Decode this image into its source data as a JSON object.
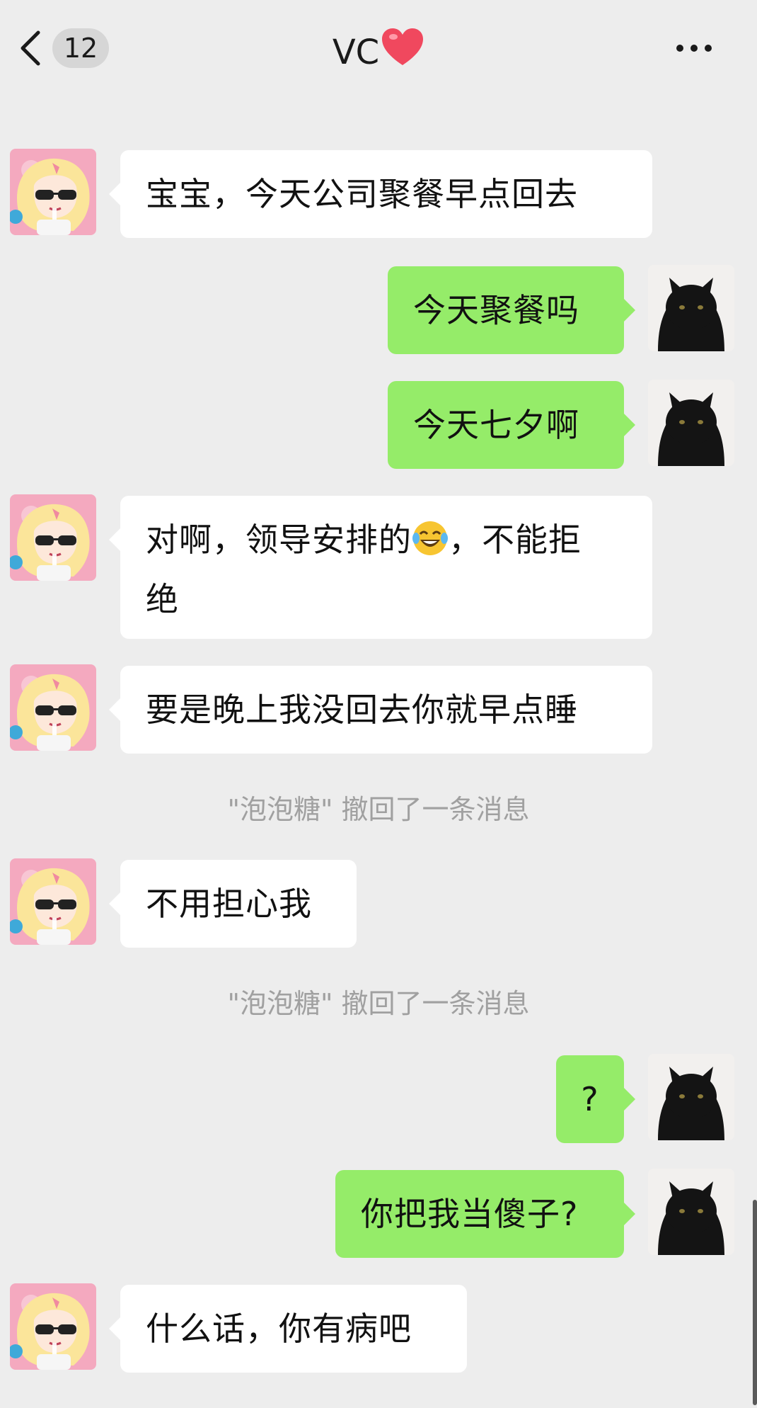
{
  "header": {
    "back_icon": "chevron-left-icon",
    "unread_count": "12",
    "title": "VC",
    "title_emoji": "heart-icon",
    "more_icon": "ellipsis-icon"
  },
  "colors": {
    "background": "#ededed",
    "incoming_bubble": "#ffffff",
    "outgoing_bubble": "#95ec69",
    "system_text": "#a0a0a0"
  },
  "messages": [
    {
      "side": "in",
      "text": "宝宝，今天公司聚餐早点回去"
    },
    {
      "side": "out",
      "text": "今天聚餐吗"
    },
    {
      "side": "out",
      "text": "今天七夕啊"
    },
    {
      "side": "in",
      "text_line1_a": "对啊，领导安排的",
      "emoji": "tears-of-joy-emoji",
      "text_line1_b": "，不能拒",
      "text_line2": "绝"
    },
    {
      "side": "in",
      "text": "要是晚上我没回去你就早点睡"
    },
    {
      "side": "system",
      "text": "\"泡泡糖\" 撤回了一条消息"
    },
    {
      "side": "in",
      "text": "不用担心我"
    },
    {
      "side": "system",
      "text": "\"泡泡糖\" 撤回了一条消息"
    },
    {
      "side": "out",
      "text": "?"
    },
    {
      "side": "out",
      "text": "你把我当傻子?"
    },
    {
      "side": "in",
      "text": "什么话，你有病吧"
    }
  ]
}
